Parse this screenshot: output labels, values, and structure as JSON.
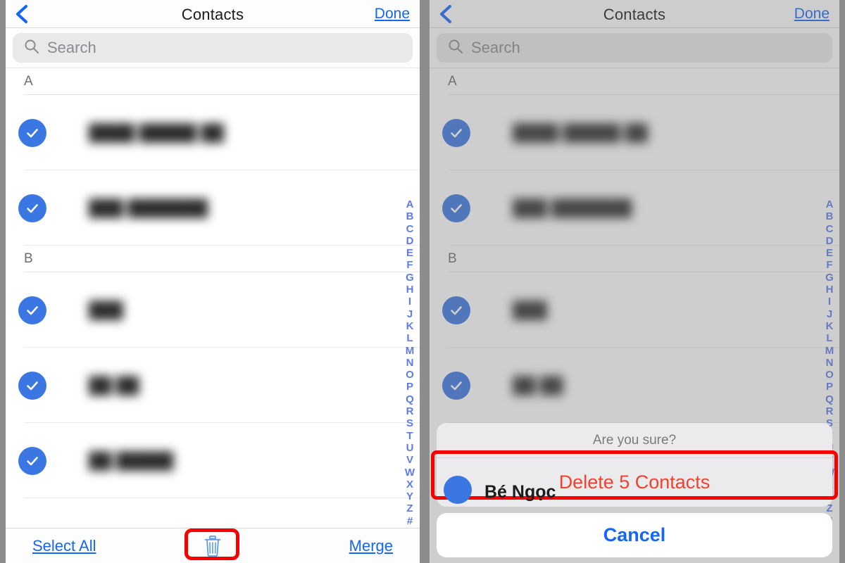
{
  "nav": {
    "back_icon": "back-chevron-icon",
    "title": "Contacts",
    "done_label": "Done"
  },
  "search": {
    "icon": "search-icon",
    "placeholder": "Search"
  },
  "sections": [
    {
      "header": "A",
      "contacts": [
        {
          "name": "████ █████ ██",
          "selected": true
        },
        {
          "name": "███ ███████",
          "selected": true
        }
      ]
    },
    {
      "header": "B",
      "contacts": [
        {
          "name": "███",
          "selected": true
        },
        {
          "name": "██ ██",
          "selected": true
        },
        {
          "name": "██ █████",
          "selected": true
        }
      ]
    }
  ],
  "alphabet_index": [
    "A",
    "B",
    "C",
    "D",
    "E",
    "F",
    "G",
    "H",
    "I",
    "J",
    "K",
    "L",
    "M",
    "N",
    "O",
    "P",
    "Q",
    "R",
    "S",
    "T",
    "U",
    "V",
    "W",
    "X",
    "Y",
    "Z",
    "#"
  ],
  "toolbar": {
    "select_all_label": "Select All",
    "delete_icon": "trash-icon",
    "merge_label": "Merge"
  },
  "action_sheet": {
    "title": "Are you sure?",
    "destructive_label": "Delete 5 Contacts",
    "cancel_label": "Cancel",
    "behind_contact_name": "Bé Ngọc"
  },
  "annotations": {
    "trash_highlight_color": "#f80000",
    "delete_highlight_color": "#f80000"
  },
  "colors": {
    "accent_blue": "#1466f5",
    "check_blue": "#3b77e3",
    "destructive_red": "#f0422e",
    "index_blue": "#5d7ce8"
  }
}
